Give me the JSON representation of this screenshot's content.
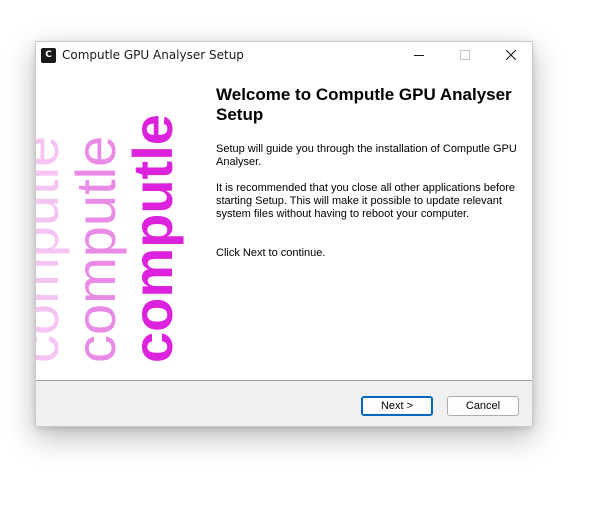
{
  "window": {
    "title": "Computle GPU Analyser Setup",
    "icon_letter": "C"
  },
  "titlebar_buttons": {
    "minimize_icon": "minimize-icon",
    "maximize_icon": "maximize-icon",
    "close_icon": "close-icon"
  },
  "banner": {
    "word": "computle",
    "colors": [
      "#f6c4f3",
      "#e98ae6",
      "#dd22dd"
    ]
  },
  "content": {
    "heading": "Welcome to Computle GPU Analyser Setup",
    "paragraph1": "Setup will guide you through the installation of Computle GPU Analyser.",
    "paragraph2": "It is recommended that you close all other applications before starting Setup. This will make it possible to update relevant system files without having to reboot your computer.",
    "paragraph3": "Click Next to continue."
  },
  "footer": {
    "next_label": "Next >",
    "cancel_label": "Cancel"
  }
}
